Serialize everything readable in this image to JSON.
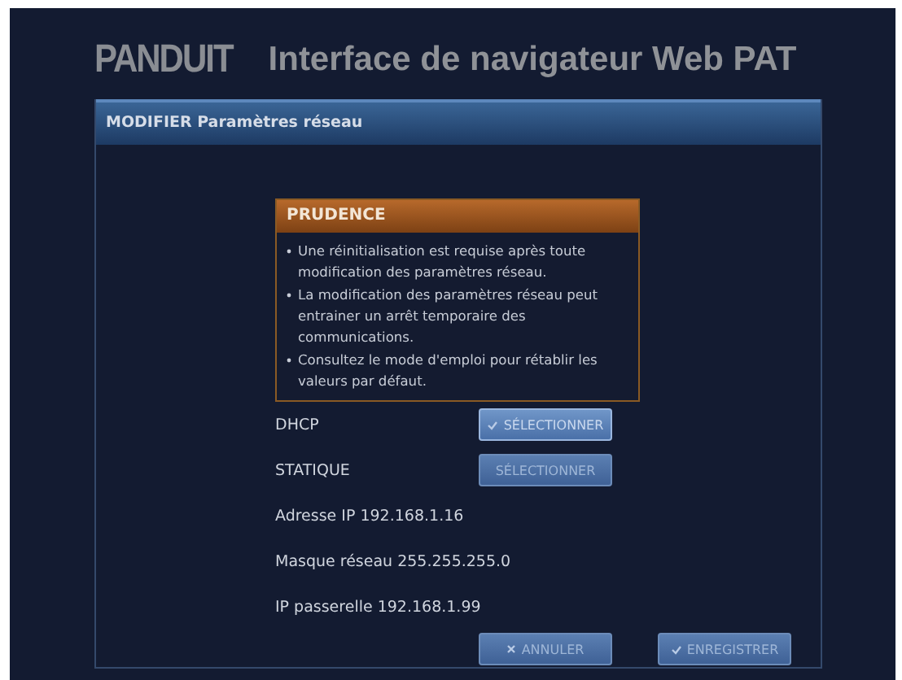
{
  "header": {
    "logo": "PANDUIT",
    "title": "Interface de navigateur Web PAT"
  },
  "panel": {
    "title": "MODIFIER Paramètres réseau",
    "caution": {
      "title": "PRUDENCE",
      "items": [
        "Une réinitialisation est requise après toute modification des paramètres réseau.",
        "La modification des paramètres réseau peut entrainer un arrêt temporaire des communications.",
        "Consultez le mode d'emploi pour rétablir les valeurs par défaut."
      ]
    },
    "modes": [
      {
        "label": "DHCP",
        "button": "SÉLECTIONNER",
        "selected": true
      },
      {
        "label": "STATIQUE",
        "button": "SÉLECTIONNER",
        "selected": false
      }
    ],
    "fields": [
      "Adresse IP 192.168.1.16",
      "Masque réseau 255.255.255.0",
      "IP passerelle 192.168.1.99"
    ],
    "actions": [
      {
        "kind": "cancel",
        "label": "ANNULER"
      },
      {
        "kind": "save",
        "label": "ENREGISTRER"
      }
    ]
  }
}
